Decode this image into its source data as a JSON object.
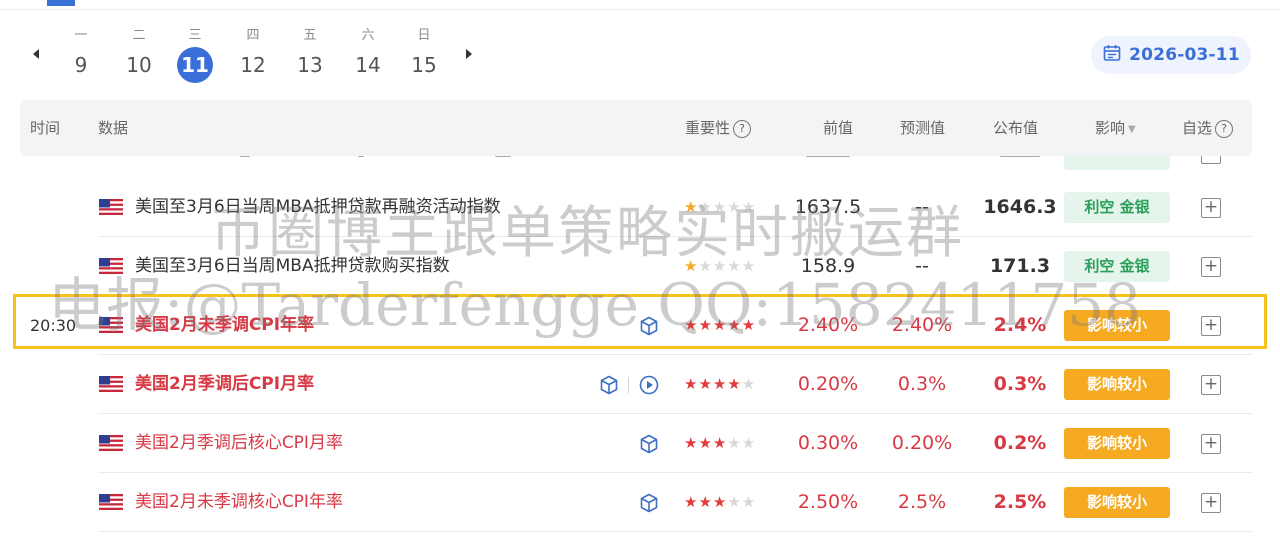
{
  "calendar": {
    "days": [
      {
        "weekday": "一",
        "date": "9"
      },
      {
        "weekday": "二",
        "date": "10"
      },
      {
        "weekday": "三",
        "date": "11"
      },
      {
        "weekday": "四",
        "date": "12"
      },
      {
        "weekday": "五",
        "date": "13"
      },
      {
        "weekday": "六",
        "date": "14"
      },
      {
        "weekday": "日",
        "date": "15"
      }
    ],
    "selected_date": "2026-03-11"
  },
  "table": {
    "headers": {
      "time": "时间",
      "data": "数据",
      "importance": "重要性",
      "previous": "前值",
      "forecast": "预测值",
      "actual": "公布值",
      "impact": "影响",
      "watchlist": "自选"
    },
    "rows": [
      {
        "time": "",
        "name": "美国至3月6日当周MBA抵押贷款再融资活动指数",
        "stars": 1,
        "previous": "1637.5",
        "forecast": "--",
        "actual": "1646.3",
        "impact": "利空 金银"
      },
      {
        "time": "",
        "name": "美国至3月6日当周MBA抵押贷款购买指数",
        "stars": 1,
        "previous": "158.9",
        "forecast": "--",
        "actual": "171.3",
        "impact": "利空 金银"
      },
      {
        "time": "20:30",
        "name": "美国2月未季调CPI年率",
        "stars": 5,
        "previous": "2.40%",
        "forecast": "2.40%",
        "actual": "2.4%",
        "impact": "影响较小"
      },
      {
        "time": "",
        "name": "美国2月季调后CPI月率",
        "stars": 4,
        "previous": "0.20%",
        "forecast": "0.3%",
        "actual": "0.3%",
        "impact": "影响较小"
      },
      {
        "time": "",
        "name": "美国2月季调后核心CPI月率",
        "stars": 3,
        "previous": "0.30%",
        "forecast": "0.20%",
        "actual": "0.2%",
        "impact": "影响较小"
      },
      {
        "time": "",
        "name": "美国2月未季调核心CPI年率",
        "stars": 3,
        "previous": "2.50%",
        "forecast": "2.5%",
        "actual": "2.5%",
        "impact": "影响较小"
      }
    ]
  },
  "watermark": {
    "line1": "币圈博主跟单策略实时搬运群",
    "line2": "电报:@Tarderfengge QQ:1582411758"
  },
  "colors": {
    "accent": "#3b6fd8",
    "positive_red": "#d83a45",
    "bullish_tag_green": "#2aa05a",
    "impact_orange": "#f5aa22",
    "highlight_yellow": "#f6c21c"
  },
  "icons": {
    "flag": "us-flag-icon",
    "cube": "cube-icon",
    "play": "play-circle-icon",
    "calendar": "calendar-icon",
    "help": "question-circle-icon"
  }
}
